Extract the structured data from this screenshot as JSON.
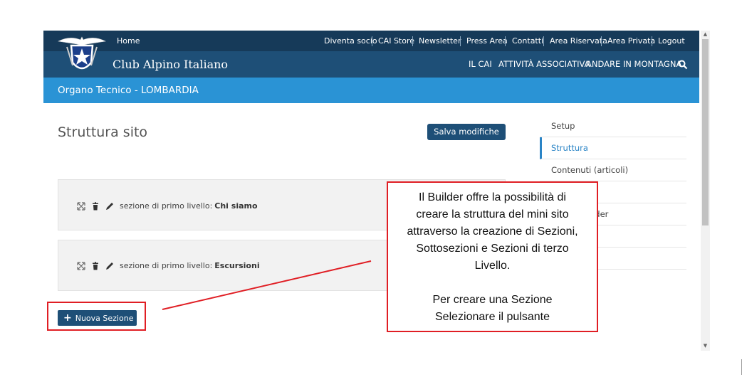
{
  "topbar": {
    "home": "Home",
    "links": [
      "Diventa socio",
      "CAI Store",
      "Newsletter",
      "Press Area",
      "Contatti",
      "Area Riservata",
      "Area Privata",
      "Logout"
    ]
  },
  "mainbar": {
    "brand": "Club Alpino Italiano",
    "menu": [
      "IL CAI",
      "ATTIVITÀ ASSOCIATIVA",
      "ANDARE IN MONTAGNA"
    ],
    "search_icon": "search-icon"
  },
  "org": {
    "title": "Organo Tecnico - LOMBARDIA"
  },
  "main": {
    "title": "Struttura sito",
    "save_label": "Salva modifiche",
    "sections": [
      {
        "prefix": "sezione di primo livello:",
        "name": "Chi siamo"
      },
      {
        "prefix": "sezione di primo livello:",
        "name": "Escursioni"
      }
    ],
    "new_section_label": "Nuova Sezione"
  },
  "sidebar": {
    "items": [
      {
        "label": "Setup"
      },
      {
        "label": "Struttura"
      },
      {
        "label": "Contenuti (articoli)"
      },
      {
        "label": ""
      },
      {
        "label": "uder"
      },
      {
        "label": ""
      },
      {
        "label": ""
      }
    ]
  },
  "callout": {
    "lines": [
      "Il Builder offre la possibilità di",
      "creare la struttura del mini sito",
      "attraverso la creazione di Sezioni,",
      "Sottosezioni e Sezioni di terzo",
      "Livello.",
      "",
      "Per creare una Sezione",
      "Selezionare il pulsante"
    ]
  },
  "colors": {
    "topbar": "#163a59",
    "mainbar": "#1e4f77",
    "bluebar": "#2a93d5",
    "annotation": "#e01e24"
  }
}
